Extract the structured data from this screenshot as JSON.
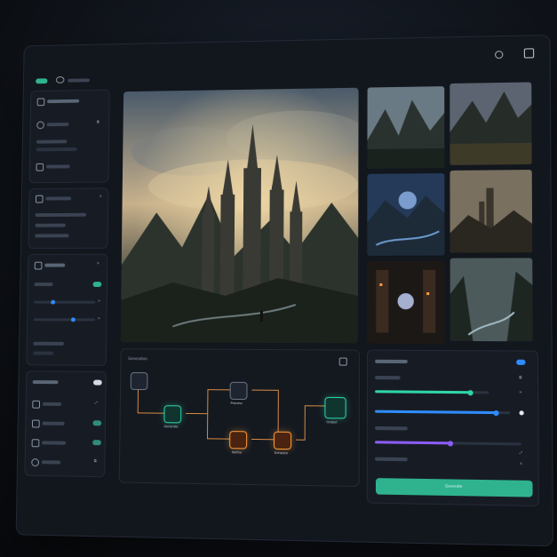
{
  "app": {
    "accent": "#2fb38f",
    "secondary_accent": "#ff9a3b",
    "blue": "#2f8cff"
  },
  "header": {
    "icons": [
      "search-icon",
      "window-icon"
    ]
  },
  "sidebar": {
    "sections": [
      {
        "name": "section-1",
        "rows": 3
      },
      {
        "name": "section-2",
        "rows": 3
      },
      {
        "name": "section-3",
        "rows": 4
      },
      {
        "name": "section-4",
        "rows": 5
      }
    ]
  },
  "main": {
    "preview_scene": "hero-image",
    "gallery_count": 6
  },
  "graph": {
    "title": "Generation",
    "nodes": [
      {
        "id": "input",
        "label": ""
      },
      {
        "id": "n1",
        "label": "Generate"
      },
      {
        "id": "n2",
        "label": "Process"
      },
      {
        "id": "n3",
        "label": "Refine"
      },
      {
        "id": "n4",
        "label": "Enhance"
      },
      {
        "id": "n5",
        "label": "Output"
      }
    ]
  },
  "controls": {
    "sliders": [
      {
        "name": "slider-1",
        "value": 0.84,
        "color": "#2fd6a6"
      },
      {
        "name": "slider-2",
        "value": 0.9,
        "color": "#2f8cff"
      },
      {
        "name": "slider-3",
        "value": 0.52,
        "color": "#8b5cf6"
      }
    ],
    "generate_label": "Generate"
  }
}
